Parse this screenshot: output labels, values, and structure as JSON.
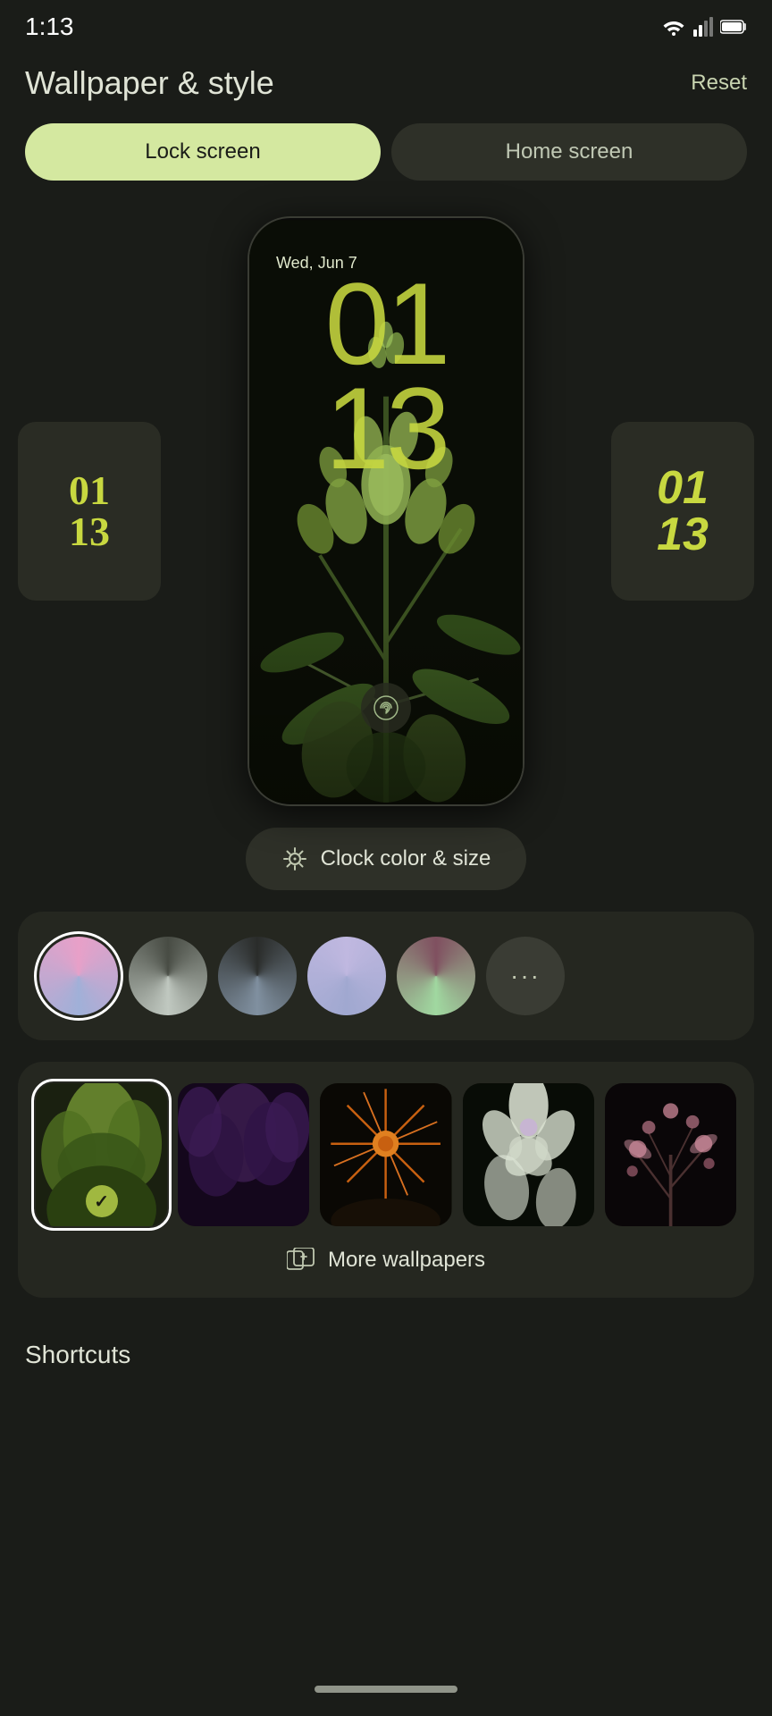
{
  "statusBar": {
    "time": "1:13",
    "wifiIcon": "wifi",
    "signalIcon": "signal",
    "batteryIcon": "battery"
  },
  "header": {
    "title": "Wallpaper & style",
    "resetLabel": "Reset"
  },
  "tabs": [
    {
      "id": "lock",
      "label": "Lock screen",
      "active": true
    },
    {
      "id": "home",
      "label": "Home screen",
      "active": false
    }
  ],
  "phonePreview": {
    "date": "Wed, Jun 7",
    "clockHour": "01",
    "clockMinute": "13"
  },
  "leftThumb": {
    "clockHour": "01",
    "clockMinute": "13"
  },
  "rightThumb": {
    "clockHour": "01",
    "clockMinute": "13"
  },
  "clockBtn": {
    "label": "Clock color & size"
  },
  "palette": {
    "swatches": [
      {
        "id": 1,
        "selected": true
      },
      {
        "id": 2,
        "selected": false
      },
      {
        "id": 3,
        "selected": false
      },
      {
        "id": 4,
        "selected": false
      },
      {
        "id": 5,
        "selected": false
      }
    ],
    "moreLabel": "···"
  },
  "wallpapers": {
    "thumbs": [
      {
        "id": 1,
        "selected": true
      },
      {
        "id": 2,
        "selected": false
      },
      {
        "id": 3,
        "selected": false
      },
      {
        "id": 4,
        "selected": false
      },
      {
        "id": 5,
        "selected": false
      }
    ],
    "moreLabel": "More wallpapers"
  },
  "shortcuts": {
    "label": "Shortcuts"
  }
}
